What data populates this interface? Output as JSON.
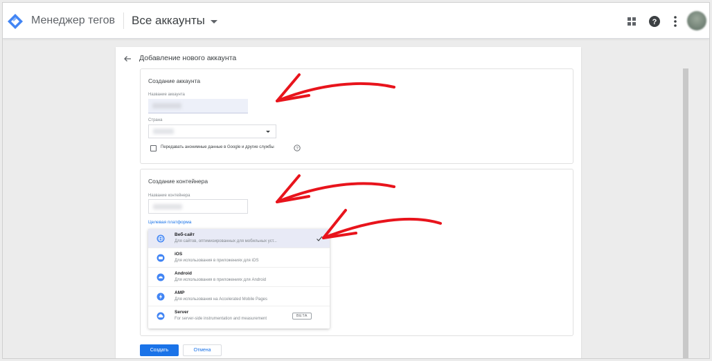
{
  "topbar": {
    "app_title": "Менеджер тегов",
    "account_selector": "Все аккаунты",
    "icons": [
      "apps-icon",
      "help-icon",
      "more-vert-icon",
      "avatar"
    ]
  },
  "page": {
    "title": "Добавление нового аккаунта"
  },
  "account_section": {
    "title": "Создание аккаунта",
    "name_label": "Название аккаунта",
    "country_label": "Страна",
    "share_checkbox_label": "Передавать анонимные данные в Google и другие службы"
  },
  "container_section": {
    "title": "Создание контейнера",
    "name_label": "Название контейнера",
    "platform_label": "Целевая платформа",
    "platforms": [
      {
        "name": "Веб-сайт",
        "desc": "Для сайтов, оптимизированных для мобильных уст...",
        "selected": true,
        "icon": "web-globe-icon"
      },
      {
        "name": "iOS",
        "desc": "Для использования в приложениях для iOS",
        "selected": false,
        "icon": "ios-icon"
      },
      {
        "name": "Android",
        "desc": "Для использования в приложениях для Android",
        "selected": false,
        "icon": "android-icon"
      },
      {
        "name": "AMP",
        "desc": "Для использования на Accelerated Mobile Pages",
        "selected": false,
        "icon": "amp-bolt-icon"
      },
      {
        "name": "Server",
        "desc": "For server-side instrumentation and measurement",
        "selected": false,
        "icon": "cloud-icon",
        "badge": "BETA"
      }
    ]
  },
  "actions": {
    "create_label": "Создать",
    "cancel_label": "Отмена"
  },
  "colors": {
    "accent": "#1a73e8",
    "annotation_arrow": "#e8141c",
    "logo_blue": "#4285f4"
  }
}
